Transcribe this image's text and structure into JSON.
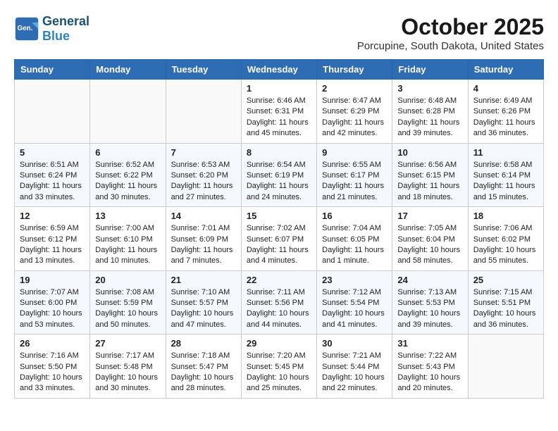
{
  "header": {
    "logo_general": "General",
    "logo_blue": "Blue",
    "month_title": "October 2025",
    "location": "Porcupine, South Dakota, United States"
  },
  "days_of_week": [
    "Sunday",
    "Monday",
    "Tuesday",
    "Wednesday",
    "Thursday",
    "Friday",
    "Saturday"
  ],
  "weeks": [
    [
      {
        "day": "",
        "info": ""
      },
      {
        "day": "",
        "info": ""
      },
      {
        "day": "",
        "info": ""
      },
      {
        "day": "1",
        "info": "Sunrise: 6:46 AM\nSunset: 6:31 PM\nDaylight: 11 hours and 45 minutes."
      },
      {
        "day": "2",
        "info": "Sunrise: 6:47 AM\nSunset: 6:29 PM\nDaylight: 11 hours and 42 minutes."
      },
      {
        "day": "3",
        "info": "Sunrise: 6:48 AM\nSunset: 6:28 PM\nDaylight: 11 hours and 39 minutes."
      },
      {
        "day": "4",
        "info": "Sunrise: 6:49 AM\nSunset: 6:26 PM\nDaylight: 11 hours and 36 minutes."
      }
    ],
    [
      {
        "day": "5",
        "info": "Sunrise: 6:51 AM\nSunset: 6:24 PM\nDaylight: 11 hours and 33 minutes."
      },
      {
        "day": "6",
        "info": "Sunrise: 6:52 AM\nSunset: 6:22 PM\nDaylight: 11 hours and 30 minutes."
      },
      {
        "day": "7",
        "info": "Sunrise: 6:53 AM\nSunset: 6:20 PM\nDaylight: 11 hours and 27 minutes."
      },
      {
        "day": "8",
        "info": "Sunrise: 6:54 AM\nSunset: 6:19 PM\nDaylight: 11 hours and 24 minutes."
      },
      {
        "day": "9",
        "info": "Sunrise: 6:55 AM\nSunset: 6:17 PM\nDaylight: 11 hours and 21 minutes."
      },
      {
        "day": "10",
        "info": "Sunrise: 6:56 AM\nSunset: 6:15 PM\nDaylight: 11 hours and 18 minutes."
      },
      {
        "day": "11",
        "info": "Sunrise: 6:58 AM\nSunset: 6:14 PM\nDaylight: 11 hours and 15 minutes."
      }
    ],
    [
      {
        "day": "12",
        "info": "Sunrise: 6:59 AM\nSunset: 6:12 PM\nDaylight: 11 hours and 13 minutes."
      },
      {
        "day": "13",
        "info": "Sunrise: 7:00 AM\nSunset: 6:10 PM\nDaylight: 11 hours and 10 minutes."
      },
      {
        "day": "14",
        "info": "Sunrise: 7:01 AM\nSunset: 6:09 PM\nDaylight: 11 hours and 7 minutes."
      },
      {
        "day": "15",
        "info": "Sunrise: 7:02 AM\nSunset: 6:07 PM\nDaylight: 11 hours and 4 minutes."
      },
      {
        "day": "16",
        "info": "Sunrise: 7:04 AM\nSunset: 6:05 PM\nDaylight: 11 hours and 1 minute."
      },
      {
        "day": "17",
        "info": "Sunrise: 7:05 AM\nSunset: 6:04 PM\nDaylight: 10 hours and 58 minutes."
      },
      {
        "day": "18",
        "info": "Sunrise: 7:06 AM\nSunset: 6:02 PM\nDaylight: 10 hours and 55 minutes."
      }
    ],
    [
      {
        "day": "19",
        "info": "Sunrise: 7:07 AM\nSunset: 6:00 PM\nDaylight: 10 hours and 53 minutes."
      },
      {
        "day": "20",
        "info": "Sunrise: 7:08 AM\nSunset: 5:59 PM\nDaylight: 10 hours and 50 minutes."
      },
      {
        "day": "21",
        "info": "Sunrise: 7:10 AM\nSunset: 5:57 PM\nDaylight: 10 hours and 47 minutes."
      },
      {
        "day": "22",
        "info": "Sunrise: 7:11 AM\nSunset: 5:56 PM\nDaylight: 10 hours and 44 minutes."
      },
      {
        "day": "23",
        "info": "Sunrise: 7:12 AM\nSunset: 5:54 PM\nDaylight: 10 hours and 41 minutes."
      },
      {
        "day": "24",
        "info": "Sunrise: 7:13 AM\nSunset: 5:53 PM\nDaylight: 10 hours and 39 minutes."
      },
      {
        "day": "25",
        "info": "Sunrise: 7:15 AM\nSunset: 5:51 PM\nDaylight: 10 hours and 36 minutes."
      }
    ],
    [
      {
        "day": "26",
        "info": "Sunrise: 7:16 AM\nSunset: 5:50 PM\nDaylight: 10 hours and 33 minutes."
      },
      {
        "day": "27",
        "info": "Sunrise: 7:17 AM\nSunset: 5:48 PM\nDaylight: 10 hours and 30 minutes."
      },
      {
        "day": "28",
        "info": "Sunrise: 7:18 AM\nSunset: 5:47 PM\nDaylight: 10 hours and 28 minutes."
      },
      {
        "day": "29",
        "info": "Sunrise: 7:20 AM\nSunset: 5:45 PM\nDaylight: 10 hours and 25 minutes."
      },
      {
        "day": "30",
        "info": "Sunrise: 7:21 AM\nSunset: 5:44 PM\nDaylight: 10 hours and 22 minutes."
      },
      {
        "day": "31",
        "info": "Sunrise: 7:22 AM\nSunset: 5:43 PM\nDaylight: 10 hours and 20 minutes."
      },
      {
        "day": "",
        "info": ""
      }
    ]
  ]
}
